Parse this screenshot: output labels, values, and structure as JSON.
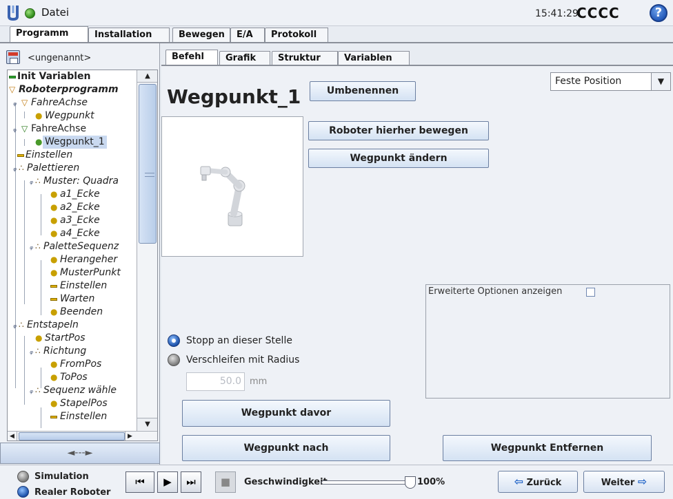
{
  "topbar": {
    "file_menu": "Datei",
    "clock": "15:41:29",
    "robot_name": "CCCC",
    "help": "?"
  },
  "main_tabs": [
    "Programm",
    "Installation",
    "Bewegen",
    "E/A",
    "Protokoll"
  ],
  "program": {
    "name": "<ungenannt>"
  },
  "tree": {
    "items": [
      {
        "label": "Init Variablen",
        "style": "bold",
        "icon": "green-bar-icon"
      },
      {
        "label": "Roboterprogramm",
        "style": "bold-italic",
        "icon": "triangle-down-icon"
      },
      {
        "label": "FahreAchse",
        "style": "italic",
        "icon": "triangle-down-icon"
      },
      {
        "label": "Wegpunkt",
        "style": "italic",
        "icon": "yellow-dot-icon"
      },
      {
        "label": "FahreAchse",
        "style": "normal",
        "icon": "triangle-down-icon"
      },
      {
        "label": "Wegpunkt_1",
        "style": "normal",
        "icon": "green-dot-icon",
        "selected": true
      },
      {
        "label": "Einstellen",
        "style": "italic",
        "icon": "yellow-bar-icon"
      },
      {
        "label": "Palettieren",
        "style": "italic",
        "icon": "pallet-icon"
      },
      {
        "label": "Muster: Quadra",
        "style": "italic",
        "icon": "pallet-icon"
      },
      {
        "label": "a1_Ecke",
        "style": "italic",
        "icon": "yellow-dot-icon"
      },
      {
        "label": "a2_Ecke",
        "style": "italic",
        "icon": "yellow-dot-icon"
      },
      {
        "label": "a3_Ecke",
        "style": "italic",
        "icon": "yellow-dot-icon"
      },
      {
        "label": "a4_Ecke",
        "style": "italic",
        "icon": "yellow-dot-icon"
      },
      {
        "label": "PaletteSequenz",
        "style": "italic",
        "icon": "pallet-icon"
      },
      {
        "label": "Herangeher",
        "style": "italic",
        "icon": "yellow-dot-icon"
      },
      {
        "label": "MusterPunkt",
        "style": "italic",
        "icon": "yellow-dot-icon"
      },
      {
        "label": "Einstellen",
        "style": "italic",
        "icon": "yellow-bar-icon"
      },
      {
        "label": "Warten",
        "style": "italic",
        "icon": "yellow-bar-icon"
      },
      {
        "label": "Beenden",
        "style": "italic",
        "icon": "yellow-dot-icon"
      },
      {
        "label": "Entstapeln",
        "style": "italic",
        "icon": "pallet-icon"
      },
      {
        "label": "StartPos",
        "style": "italic",
        "icon": "yellow-dot-icon"
      },
      {
        "label": "Richtung",
        "style": "italic",
        "icon": "pallet-icon"
      },
      {
        "label": "FromPos",
        "style": "italic",
        "icon": "yellow-dot-icon"
      },
      {
        "label": "ToPos",
        "style": "italic",
        "icon": "yellow-dot-icon"
      },
      {
        "label": "Sequenz wähle",
        "style": "italic",
        "icon": "pallet-icon"
      },
      {
        "label": "StapelPos",
        "style": "italic",
        "icon": "yellow-dot-icon"
      },
      {
        "label": "Einstellen",
        "style": "italic",
        "icon": "yellow-bar-icon"
      }
    ],
    "toggle": "◄---►"
  },
  "sub_tabs": [
    "Befehl",
    "Grafik",
    "Struktur",
    "Variablen"
  ],
  "waypoint": {
    "title": "Wegpunkt_1",
    "rename_button": "Umbenennen",
    "position_type": "Feste Position",
    "move_here_button": "Roboter hierher bewegen",
    "change_button": "Wegpunkt ändern",
    "advanced_label": "Erweiterte Optionen anzeigen",
    "stop_option": "Stopp an dieser Stelle",
    "blend_option": "Verschleifen mit Radius",
    "radius_value": "50.0",
    "radius_unit": "mm",
    "before_button": "Wegpunkt davor",
    "after_button": "Wegpunkt nach",
    "remove_button": "Wegpunkt Entfernen"
  },
  "bottombar": {
    "simulation": "Simulation",
    "real_robot": "Realer Roboter",
    "speed_label": "Geschwindigkeit",
    "speed_value": "100%",
    "speed_fraction": 1.0,
    "back_button": "Zurück",
    "next_button": "Weiter"
  },
  "colors": {
    "accent": "#1f56b8",
    "status_ok": "#2e8a1a",
    "selection": "#c9d9f0"
  }
}
